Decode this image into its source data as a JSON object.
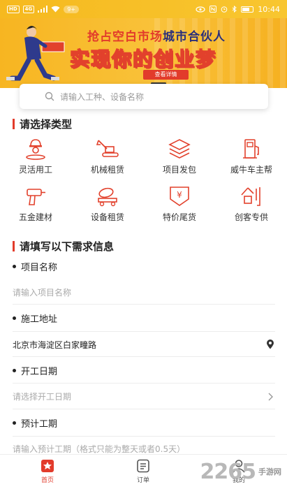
{
  "status_bar": {
    "left_badge_1": "HD",
    "left_badge_2": "4G",
    "notification_count": "9+",
    "time": "10:44"
  },
  "banner": {
    "line1_red": "抢占空白市场",
    "line1_navy": "城市合伙人",
    "line2": "实现你的创业梦",
    "button": "查看详情"
  },
  "search": {
    "placeholder": "请输入工种、设备名称"
  },
  "type_section": {
    "title": "请选择类型",
    "items": [
      {
        "label": "灵活用工",
        "icon": "worker-icon"
      },
      {
        "label": "机械租赁",
        "icon": "excavator-icon"
      },
      {
        "label": "项目发包",
        "icon": "layers-icon"
      },
      {
        "label": "威牛车主帮",
        "icon": "fuel-pump-icon"
      },
      {
        "label": "五金建材",
        "icon": "drill-icon"
      },
      {
        "label": "设备租赁",
        "icon": "concrete-mixer-icon"
      },
      {
        "label": "特价尾货",
        "icon": "price-tag-icon"
      },
      {
        "label": "创客专供",
        "icon": "chuang-icon"
      }
    ]
  },
  "form_section": {
    "title": "请填写以下需求信息",
    "fields": [
      {
        "label": "项目名称",
        "placeholder": "请输入项目名称"
      },
      {
        "label": "施工地址",
        "value": "北京市海淀区白家疃路"
      },
      {
        "label": "开工日期",
        "placeholder": "请选择开工日期"
      },
      {
        "label": "预计工期",
        "placeholder": "请输入预计工期（格式只能为整天或者0.5天）"
      }
    ]
  },
  "tabbar": {
    "items": [
      {
        "label": "首页",
        "active": true
      },
      {
        "label": "订单",
        "active": false
      },
      {
        "label": "我的",
        "active": false
      }
    ]
  },
  "watermark": {
    "number": "2265",
    "site": "手游网"
  },
  "colors": {
    "accent": "#e23b2b",
    "banner": "#f8be2c"
  }
}
